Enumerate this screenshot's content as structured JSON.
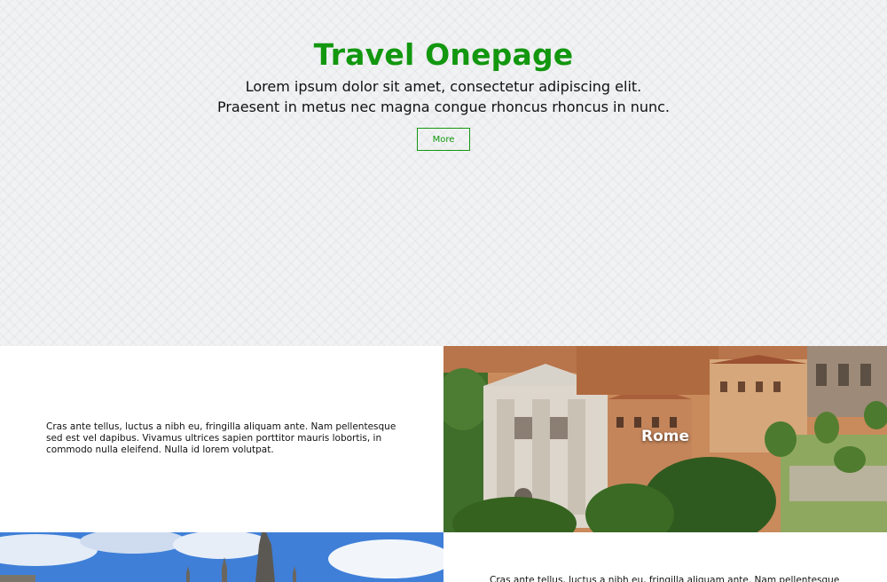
{
  "hero": {
    "title": "Travel Onepage",
    "subtitle": "Lorem ipsum dolor sit amet, consectetur adipiscing elit. Praesent in metus nec magna congue rhoncus rhoncus in nunc.",
    "button_label": "More"
  },
  "sections": [
    {
      "text": "Cras ante tellus, luctus a nibh eu, fringilla aliquam ante. Nam pellentesque sed est vel dapibus. Vivamus ultrices sapien porttitor mauris lobortis, in commodo nulla eleifend. Nulla id lorem volutpat.",
      "caption": "Rome",
      "image": "rome-photo"
    },
    {
      "image": "cathedral-photo",
      "text": "Cras ante tellus, luctus a nibh eu, fringilla aliquam ante. Nam pellentesque"
    }
  ],
  "colors": {
    "accent": "#12970f",
    "hero_background": "#f1f2f4"
  }
}
